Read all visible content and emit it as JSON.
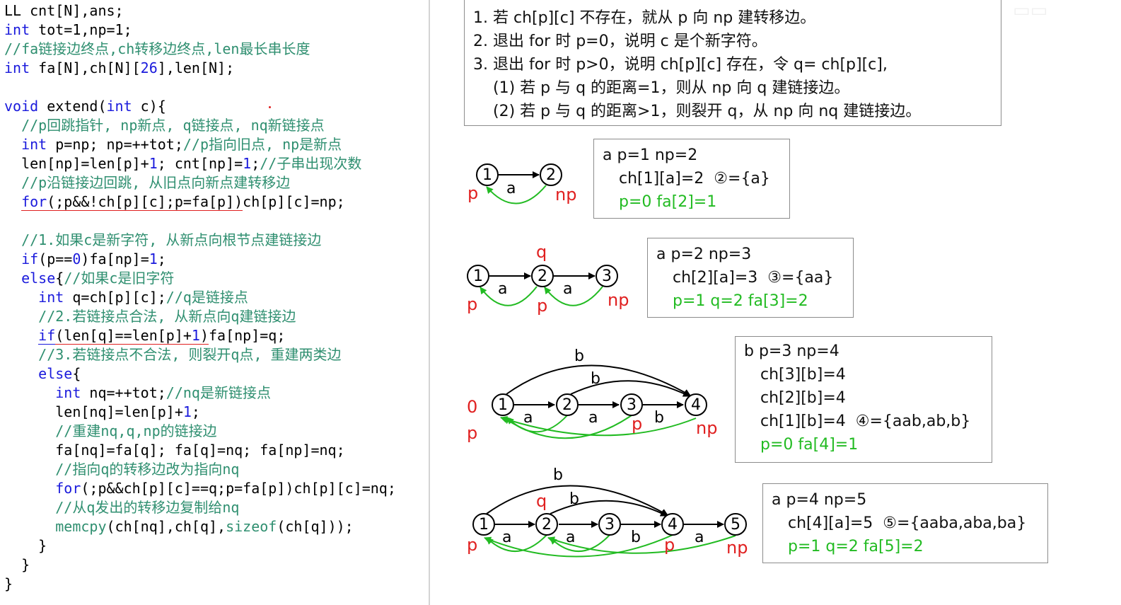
{
  "code": {
    "l01": "LL cnt[N],ans;",
    "l02": "int tot=1,np=1;",
    "l03": "//fa链接边终点,ch转移边终点,len最长串长度",
    "l04": "int fa[N],ch[N][26],len[N];",
    "l06": "void extend(int c){",
    "l07": "  //p回跳指针, np新点, q链接点, nq新链接点",
    "l08": "  int p=np; np=++tot;//p指向旧点, np是新点",
    "l09": "  len[np]=len[p]+1; cnt[np]=1;//子串出现次数",
    "l10": "  //p沿链接边回跳, 从旧点向新点建转移边",
    "l11": "  for(;p&&!ch[p][c];p=fa[p])ch[p][c]=np;",
    "l13": "  //1.如果c是新字符, 从新点向根节点建链接边",
    "l14": "  if(p==0)fa[np]=1;",
    "l15": "  else{//如果c是旧字符",
    "l16": "    int q=ch[p][c];//q是链接点",
    "l17": "    //2.若链接点合法, 从新点向q建链接边",
    "l18": "    if(len[q]==len[p]+1)fa[np]=q;",
    "l19": "    //3.若链接点不合法, 则裂开q点, 重建两类边",
    "l20": "    else{",
    "l21": "      int nq=++tot;//nq是新链接点",
    "l22": "      len[nq]=len[p]+1;",
    "l23": "      //重建nq,q,np的链接边",
    "l24": "      fa[nq]=fa[q]; fa[q]=nq; fa[np]=nq;",
    "l25": "      //指向q的转移边改为指向nq",
    "l26": "      for(;p&&ch[p][c]==q;p=fa[p])ch[p][c]=nq;",
    "l27": "      //从q发出的转移边复制给nq",
    "l28": "      memcpy(ch[nq],ch[q],sizeof(ch[q]));",
    "l29": "    }",
    "l30": "  }",
    "l31": "}"
  },
  "rules": {
    "r1": "1. 若 ch[p][c] 不存在，就从 p 向 np 建转移边。",
    "r2": "2. 退出 for 时 p=0，说明 c 是个新字符。",
    "r3": "3. 退出 for 时 p>0，说明 ch[p][c] 存在，令 q= ch[p][c],",
    "r4": "(1) 若 p 与 q 的距离=1，则从 np 向 q 建链接边。",
    "r5": "(2) 若 p 与 q 的距离>1，则裂开 q，从 np 向 nq 建链接边。"
  },
  "steps": [
    {
      "l1": "a p=1 np=2",
      "l2": "ch[1][a]=2",
      "l2b": "②={a}",
      "l3": "p=0 fa[2]=1"
    },
    {
      "l1": "a p=2 np=3",
      "l2": "ch[2][a]=3",
      "l2b": "③={aa}",
      "l3": "p=1 q=2 fa[3]=2"
    },
    {
      "l1": "b p=3 np=4",
      "l2": "ch[3][b]=4",
      "l3": "ch[2][b]=4",
      "l4": "ch[1][b]=4",
      "l4b": "④={aab,ab,b}",
      "l5": "p=0 fa[4]=1"
    },
    {
      "l1": "a p=4 np=5",
      "l2": "ch[4][a]=5",
      "l2b": "⑤={aaba,aba,ba}",
      "l3": "p=1 q=2 fa[5]=2"
    }
  ],
  "diagram": {
    "n1": "1",
    "n2": "2",
    "n3": "3",
    "n4": "4",
    "n5": "5",
    "a": "a",
    "b": "b",
    "p": "p",
    "q": "q",
    "np": "np",
    "zero": "0"
  },
  "colors": {
    "keyword": "#1a1adc",
    "comment": "#2f8f70",
    "red": "#e02020",
    "green": "#22bb22"
  }
}
